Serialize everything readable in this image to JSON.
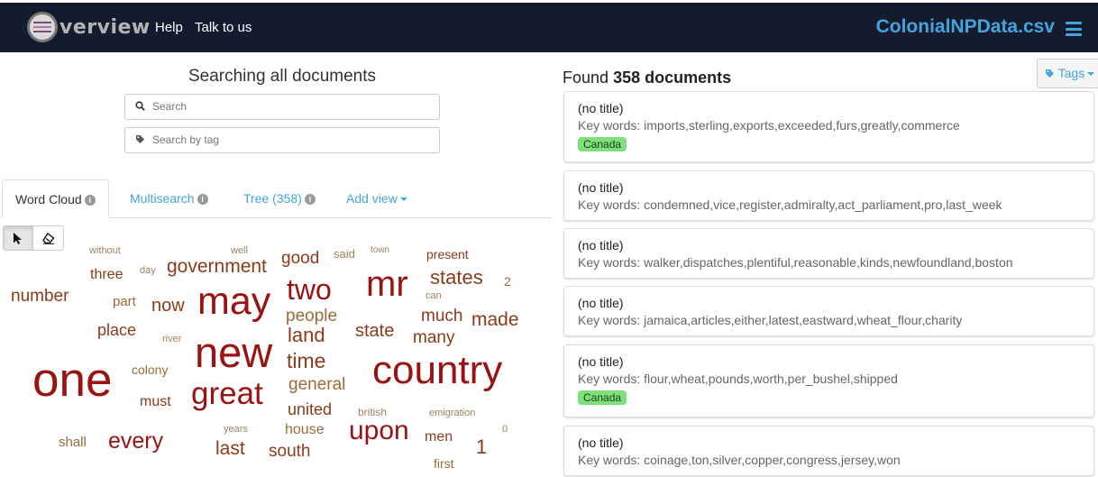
{
  "header": {
    "logo_text": "verview",
    "nav": [
      "Help",
      "Talk to us"
    ],
    "file_title": "ColonialNPData.csv"
  },
  "search": {
    "heading": "Searching all documents",
    "search_placeholder": "Search",
    "tag_placeholder": "Search by tag"
  },
  "tabs": {
    "word_cloud": "Word Cloud",
    "multisearch": "Multisearch",
    "tree": "Tree (358)",
    "add_view": "Add view"
  },
  "word_cloud": {
    "words": [
      "without",
      "well",
      "town",
      "three",
      "day",
      "government",
      "good",
      "said",
      "present",
      "states",
      "2",
      "number",
      "part",
      "now",
      "may",
      "two",
      "mr",
      "can",
      "place",
      "people",
      "much",
      "made",
      "river",
      "land",
      "state",
      "many",
      "new",
      "time",
      "colony",
      "one",
      "country",
      "general",
      "must",
      "great",
      "united",
      "british",
      "emigration",
      "years",
      "house",
      "upon",
      "0",
      "shall",
      "every",
      "last",
      "south",
      "men",
      "1",
      "first"
    ],
    "colors": {
      "dark": "#9a1212",
      "mid": "#8b3a1a",
      "light": "#9a6a3a",
      "faint": "#a08060"
    }
  },
  "results": {
    "found_prefix": "Found",
    "found_count": "358 documents",
    "tags_label": "Tags",
    "documents": [
      {
        "title": "(no title)",
        "keywords": "Key words: imports,sterling,exports,exceeded,furs,greatly,commerce",
        "tag": "Canada"
      },
      {
        "title": "(no title)",
        "keywords": "Key words: condemned,vice,register,admiralty,act_parliament,pro,last_week"
      },
      {
        "title": "(no title)",
        "keywords": "Key words: walker,dispatches,plentiful,reasonable,kinds,newfoundland,boston"
      },
      {
        "title": "(no title)",
        "keywords": "Key words: jamaica,articles,either,latest,eastward,wheat_flour,charity"
      },
      {
        "title": "(no title)",
        "keywords": "Key words: flour,wheat,pounds,worth,per_bushel,shipped",
        "tag": "Canada"
      },
      {
        "title": "(no title)",
        "keywords": "Key words: coinage,ton,silver,copper,congress,jersey,won"
      }
    ]
  }
}
